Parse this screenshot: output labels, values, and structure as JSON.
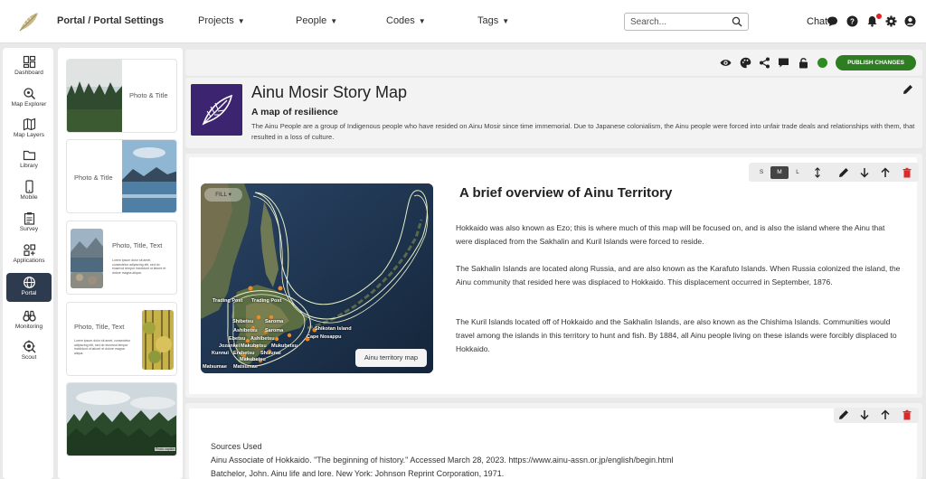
{
  "topbar": {
    "breadcrumb": "Portal / Portal Settings",
    "nav": [
      {
        "label": "Projects"
      },
      {
        "label": "People"
      },
      {
        "label": "Codes"
      },
      {
        "label": "Tags"
      }
    ],
    "search_placeholder": "Search...",
    "chat_label": "Chat",
    "icons": [
      "chat-bubble-icon",
      "help-icon",
      "bell-icon",
      "gear-icon",
      "user-icon"
    ]
  },
  "leftnav": [
    {
      "label": "Dashboard",
      "icon": "dashboard-icon"
    },
    {
      "label": "Map Explorer",
      "icon": "map-explorer-icon"
    },
    {
      "label": "Map Layers",
      "icon": "map-layers-icon"
    },
    {
      "label": "Library",
      "icon": "folder-icon"
    },
    {
      "label": "Mobile",
      "icon": "mobile-icon"
    },
    {
      "label": "Survey",
      "icon": "clipboard-icon"
    },
    {
      "label": "Applications",
      "icon": "applications-icon"
    },
    {
      "label": "Portal",
      "icon": "portal-icon",
      "active": true
    },
    {
      "label": "Monitoring",
      "icon": "binoculars-icon"
    },
    {
      "label": "Scout",
      "icon": "scout-icon"
    }
  ],
  "templates": [
    {
      "label": "Photo & Title"
    },
    {
      "label": "Photo & Title"
    },
    {
      "label": "Photo, Title, Text"
    },
    {
      "label": "Photo, Title, Text"
    },
    {
      "caption": "Photo caption"
    }
  ],
  "template_lorem": "Lorem ipsum dolor sit amet, consectetur adipiscing elit, sed do eiusmod tempor incididunt ut labore et dolore magna aliqua.",
  "toolbar": {
    "icons": [
      "eye-icon",
      "palette-icon",
      "share-icon",
      "comment-icon",
      "mobile-icon",
      "lock-icon"
    ],
    "status_color": "#2e8b22",
    "publish_label": "PUBLISH CHANGES"
  },
  "header": {
    "title": "Ainu Mosir Story Map",
    "subtitle": "A map of resilience",
    "description": "The Ainu People are a group of Indigenous people who have resided on Ainu Mosir since time immemorial. Due to Japanese colonialism, the Ainu people were forced into unfair trade deals and relationships with them, that resulted in a loss of culture.",
    "logo_color": "#3d2470"
  },
  "section1": {
    "size_options": [
      "S",
      "M",
      "L"
    ],
    "selected_size": "M",
    "tool_icons": [
      "resize-vertical-icon",
      "pencil-icon",
      "arrow-down-icon",
      "arrow-up-icon",
      "trash-icon"
    ],
    "map": {
      "fill_label": "FILL ▾",
      "button_label": "Ainu territory map",
      "places": [
        "Trading Post",
        "Trading Post",
        "Shibetsu",
        "Saroma",
        "Ashibetsu",
        "Saroma",
        "Ebetsu",
        "Ashibetsu",
        "Jozankei",
        "Makubetsu",
        "Mukubetsu",
        "Kunnui",
        "Erabetsu",
        "Shizunai",
        "Makubetsu",
        "Matsumae",
        "Matsumae",
        "Shikotan Island",
        "Cape Nosappu"
      ]
    },
    "title": "A brief overview of Ainu Territory",
    "paragraphs": [
      "Hokkaido was also known as Ezo; this is where much of this map will be focused on, and is also the island where the Ainu that were displaced from the Sakhalin and Kuril Islands were forced to reside.",
      "The Sakhalin Islands are located along Russia, and are also known as the Karafuto Islands. When Russia colonized the island, the Ainu community that resided here was displaced to Hokkaido. This displacement occurred in September, 1876.",
      "The Kuril Islands located off of Hokkaido and the Sakhalin Islands, are also known as the Chishima Islands. Communities would travel among the islands in this territory to hunt and fish. By 1884, all Ainu people living on these islands were forcibly displaced to Hokkaido."
    ]
  },
  "section2": {
    "tool_icons": [
      "pencil-icon",
      "arrow-down-icon",
      "arrow-up-icon",
      "trash-icon"
    ],
    "heading": "Sources Used",
    "sources": [
      "Ainu Associate of Hokkaido. \"The beginning of history.\" Accessed March 28, 2023. https://www.ainu-assn.or.jp/english/begin.html",
      "Batchelor, John. Ainu life and lore. New York: Johnson Reprint Corporation, 1971."
    ]
  }
}
